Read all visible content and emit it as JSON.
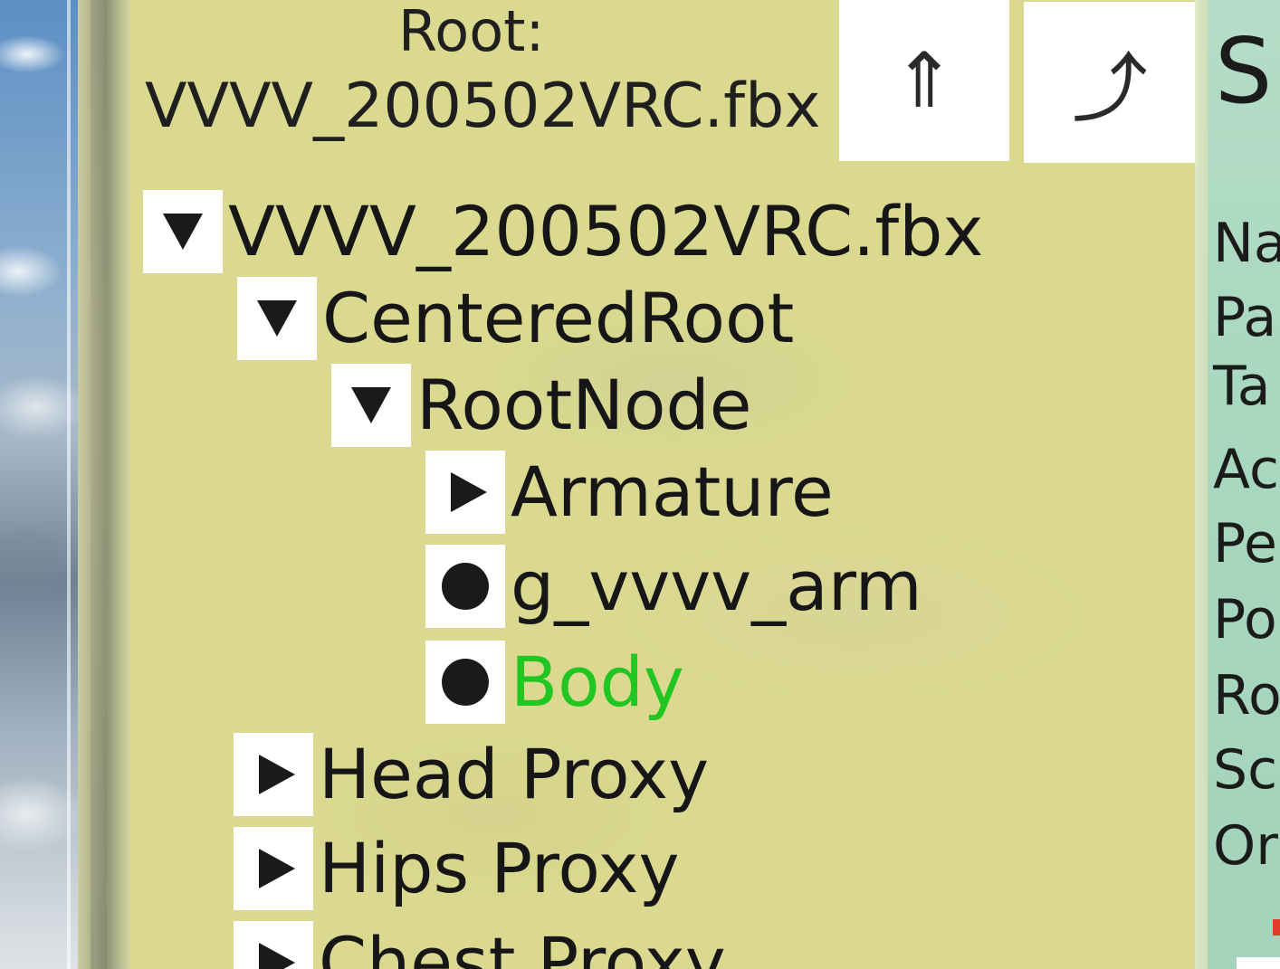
{
  "header": {
    "root_label": "Root:",
    "root_file": "VVVV_200502VRC.fbx",
    "buttons": {
      "parent_glyph": "⇑",
      "up_glyph": "⤴"
    }
  },
  "tree": [
    {
      "label": "VVVV_200502VRC.fbx",
      "state": "expanded",
      "depth": 0,
      "icon": "triangle-down-icon"
    },
    {
      "label": "CenteredRoot",
      "state": "expanded",
      "depth": 1,
      "icon": "triangle-down-icon"
    },
    {
      "label": "RootNode",
      "state": "expanded",
      "depth": 2,
      "icon": "triangle-down-icon"
    },
    {
      "label": "Armature",
      "state": "collapsed",
      "depth": 3,
      "icon": "triangle-right-icon"
    },
    {
      "label": "g_vvvv_arm",
      "state": "leaf",
      "depth": 3,
      "icon": "dot-icon"
    },
    {
      "label": "Body",
      "state": "leaf",
      "depth": 3,
      "icon": "dot-icon",
      "selected": true
    },
    {
      "label": "Head Proxy",
      "state": "collapsed",
      "depth": 1,
      "icon": "triangle-right-icon"
    },
    {
      "label": "Hips Proxy",
      "state": "collapsed",
      "depth": 1,
      "icon": "triangle-right-icon"
    },
    {
      "label": "Chest Proxy",
      "state": "collapsed",
      "depth": 1,
      "icon": "triangle-right-icon"
    }
  ],
  "side_panel": {
    "title": "S",
    "fields": [
      "Na",
      "Pa",
      "Ta",
      "Ac",
      "Pe",
      "Po",
      "Ro",
      "Sc",
      "Or"
    ]
  },
  "colors": {
    "panel_bg": "#dad98f",
    "selected_text": "#22c622",
    "side_panel_bg": "#a9d8c0"
  }
}
